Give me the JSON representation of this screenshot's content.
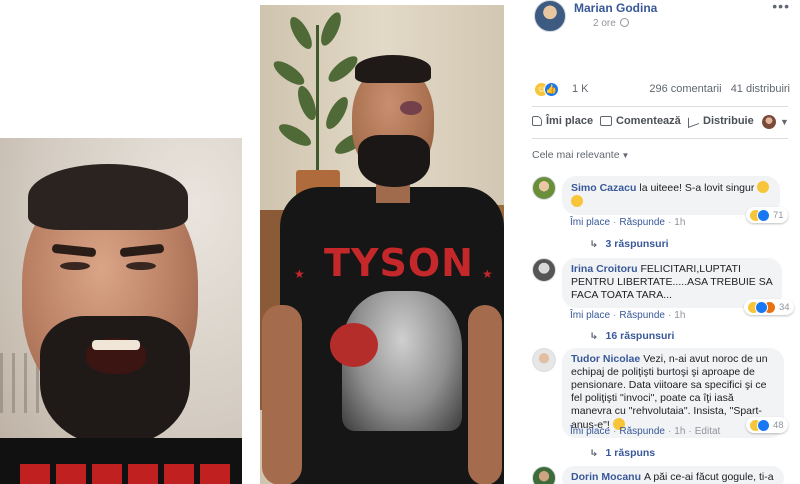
{
  "post": {
    "author": "Marian Godina",
    "time": "2 ore",
    "more": "•••"
  },
  "photos": {
    "shirt_text": "TYSON"
  },
  "stats": {
    "reactions_count": "1 K",
    "comments": "296 comentarii",
    "shares": "41 distribuiri"
  },
  "actions": {
    "like": "Îmi place",
    "comment": "Comentează",
    "share": "Distribuie"
  },
  "sort": {
    "label": "Cele mai relevante"
  },
  "comments": [
    {
      "name": "Simo Cazacu",
      "text": "la uiteee! S-a lovit singur",
      "like": "Îmi place",
      "reply": "Răspunde",
      "time": "1h",
      "reaction_count": "71",
      "replies": "3 răspunsuri"
    },
    {
      "name": "Irina Croitoru",
      "text": "FELICITARI,LUPTATI PENTRU LIBERTATE.....ASA TREBUIE SA FACA TOATA TARA...",
      "like": "Îmi place",
      "reply": "Răspunde",
      "time": "1h",
      "reaction_count": "34",
      "replies": "16 răspunsuri"
    },
    {
      "name": "Tudor Nicolae",
      "text": "Vezi, n-ai avut noroc de un echipaj de poliţişti burtoşi şi aproape de pensionare. Data viitoare sa specifici şi ce fel poliţişti \"invoci\", poate ca îţi iasă manevra cu \"rehvolutaia\". Insista, \"Spart-anus-e\"!",
      "like": "Îmi place",
      "reply": "Răspunde",
      "time": "1h",
      "edited": "Editat",
      "reaction_count": "48",
      "replies": "1 răspuns"
    },
    {
      "name": "Dorin Mocanu",
      "text": "A păi ce-ai făcut gogule, ti-a"
    }
  ],
  "colors": {
    "link": "#385898",
    "meta": "#90949c",
    "bubble": "#f2f3f5",
    "like_blue": "#1877f2",
    "haha_yellow": "#f7c53a",
    "shirt_red": "#c4282a"
  }
}
